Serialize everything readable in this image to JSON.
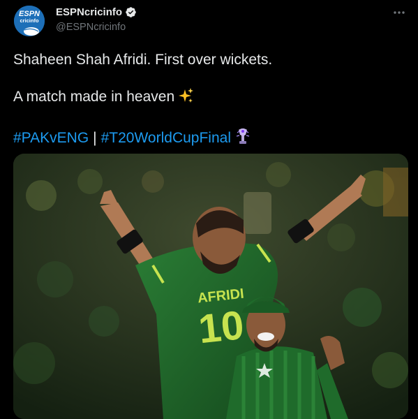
{
  "account": {
    "display_name": "ESPNcricinfo",
    "handle": "@ESPNcricinfo",
    "avatar_text_top": "ESPN",
    "avatar_text_bottom": "cricinfo"
  },
  "tweet": {
    "line1": "Shaheen Shah Afridi. First over wickets.",
    "line2": "A match made in heaven",
    "hashtag1": "#PAKvENG",
    "separator": "|",
    "hashtag2": "#T20WorldCupFinal"
  },
  "media": {
    "jersey_name": "AFRIDI",
    "jersey_number": "10"
  },
  "colors": {
    "background": "#000000",
    "text": "#e7e9ea",
    "secondary_text": "#71767b",
    "link": "#1d9bf0",
    "verified": "#e7e9ea",
    "avatar_bg": "#1d6fb8",
    "jersey_green": "#1f6b2b"
  },
  "icons": {
    "verified": "verified-badge-icon",
    "more": "more-horizontal-icon",
    "sparkles": "sparkles-emoji",
    "trophy": "trophy-emoji"
  }
}
